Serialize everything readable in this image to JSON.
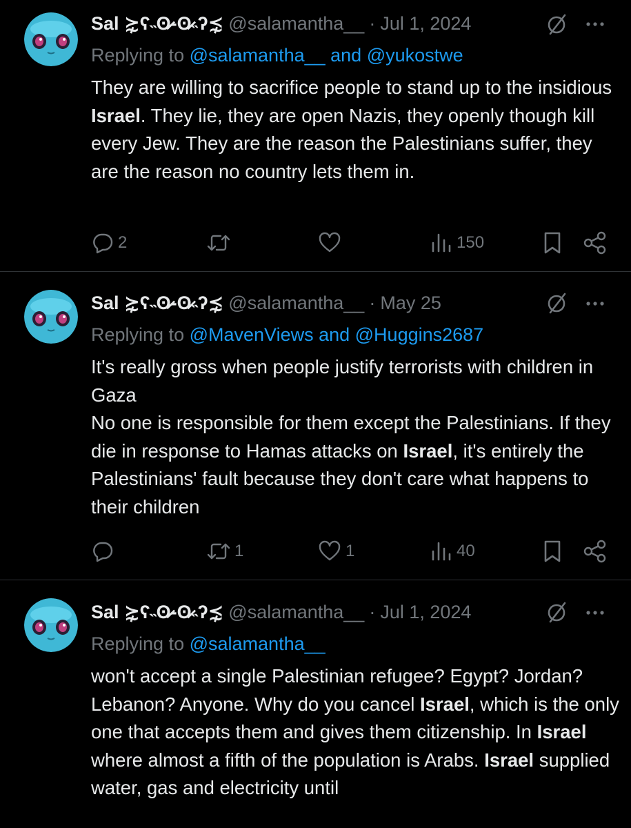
{
  "tweets": [
    {
      "display_name": "Sal ⋩ʕ˵ʘ̷-ʘ̷˵ʔ⋨",
      "handle": "@salamantha__",
      "separator": "·",
      "date": "Jul 1, 2024",
      "replying_prefix": "Replying to",
      "replying_mentions": "@salamantha__ and @yukostwe",
      "body_segments": [
        {
          "text": "They are willing to sacrifice people to stand up to the insidious ",
          "bold": false
        },
        {
          "text": "Israel",
          "bold": true
        },
        {
          "text": ". They lie, they are open Nazis, they openly though kill every Jew. They are the reason the Palestinians suffer, they are the reason no country lets them in.",
          "bold": false
        }
      ],
      "actions": {
        "replies": "2",
        "reposts": "",
        "likes": "",
        "views": "150"
      }
    },
    {
      "display_name": "Sal ⋩ʕ˵ʘ̷-ʘ̷˵ʔ⋨",
      "handle": "@salamantha__",
      "separator": "·",
      "date": "May 25",
      "replying_prefix": "Replying to",
      "replying_mentions": "@MavenViews and @Huggins2687",
      "body_segments": [
        {
          "text": "It's really gross when people justify terrorists with children in Gaza\nNo one is responsible for them except the Palestinians. If they die in response to Hamas attacks on ",
          "bold": false
        },
        {
          "text": "Israel",
          "bold": true
        },
        {
          "text": ", it's entirely the Palestinians' fault because they don't care what happens to their children",
          "bold": false
        }
      ],
      "actions": {
        "replies": "",
        "reposts": "1",
        "likes": "1",
        "views": "40"
      }
    },
    {
      "display_name": "Sal ⋩ʕ˵ʘ̷-ʘ̷˵ʔ⋨",
      "handle": "@salamantha__",
      "separator": "·",
      "date": "Jul 1, 2024",
      "replying_prefix": "Replying to",
      "replying_mentions": "@salamantha__",
      "body_segments": [
        {
          "text": "won't accept a single Palestinian refugee? Egypt? Jordan? Lebanon? Anyone. Why do you cancel ",
          "bold": false
        },
        {
          "text": "Israel",
          "bold": true
        },
        {
          "text": ", which is the only one that accepts them and gives them citizenship. In ",
          "bold": false
        },
        {
          "text": "Israel",
          "bold": true
        },
        {
          "text": " where almost a fifth of the population is Arabs. ",
          "bold": false
        },
        {
          "text": "Israel",
          "bold": true
        },
        {
          "text": " supplied water, gas and electricity until",
          "bold": false
        }
      ]
    }
  ],
  "icons": {
    "avatar": "blue-creature-avatar",
    "grok": "grok-slash-circle-icon",
    "more": "more-dots-icon",
    "reply": "reply-bubble-icon",
    "repost": "repost-arrows-icon",
    "like": "heart-icon",
    "views": "views-bars-icon",
    "bookmark": "bookmark-icon",
    "share": "share-icon"
  },
  "colors": {
    "background": "#000000",
    "text": "#e7e9ea",
    "muted": "#71767b",
    "link": "#1d9bf0",
    "divider": "#2f3336",
    "avatar": "#3fb8d6"
  }
}
